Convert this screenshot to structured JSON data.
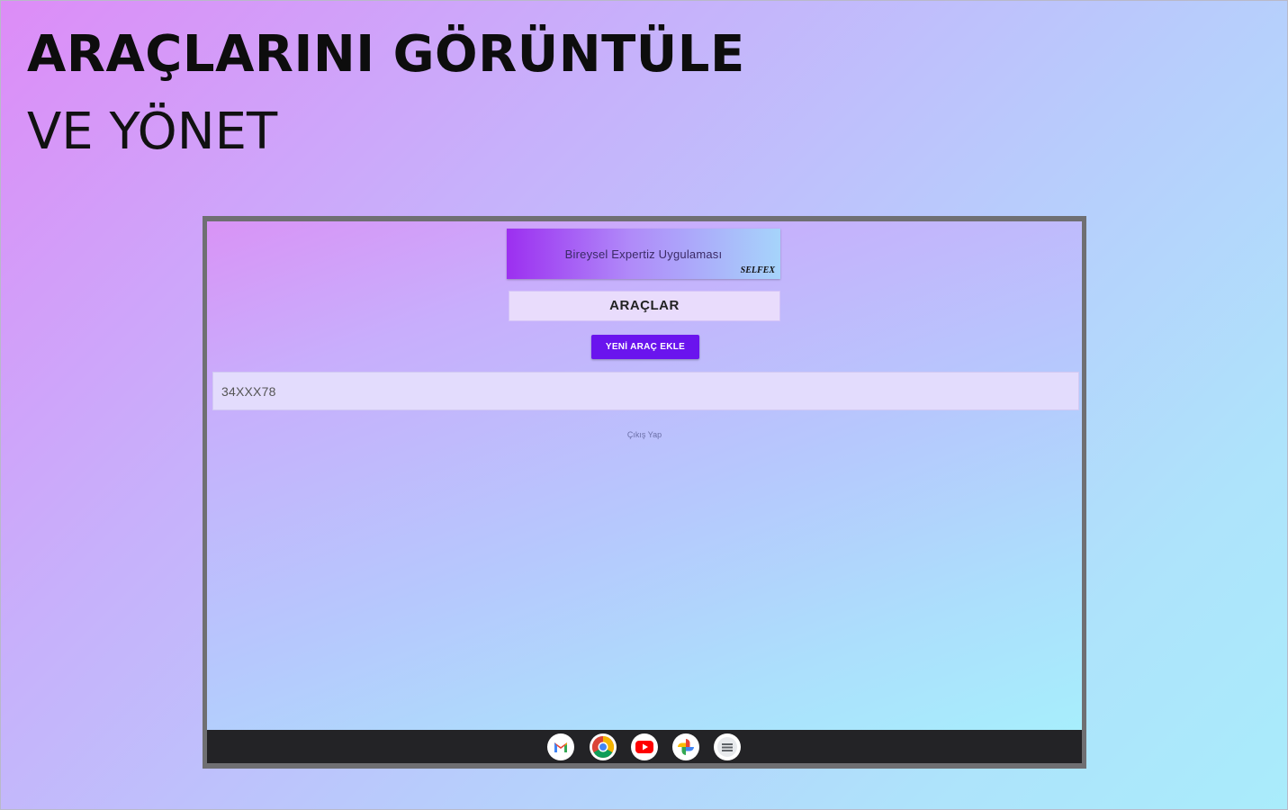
{
  "promo": {
    "title": "ARAÇLARINI GÖRÜNTÜLE",
    "subtitle": "VE YÖNET"
  },
  "app": {
    "banner_text": "Bireysel Expertiz Uygulaması",
    "banner_brand": "SELFEX",
    "section_title": "ARAÇLAR",
    "add_button_label": "YENİ ARAÇ EKLE",
    "vehicles": [
      {
        "plate": "34XXX78"
      }
    ],
    "logout_label": "Çıkış Yap"
  },
  "shelf": {
    "apps": [
      "gmail-icon",
      "chrome-icon",
      "youtube-icon",
      "photos-icon",
      "files-icon"
    ]
  },
  "colors": {
    "accent": "#6a14ee",
    "shelf_background": "#232326",
    "device_frame": "#6f6f72"
  }
}
